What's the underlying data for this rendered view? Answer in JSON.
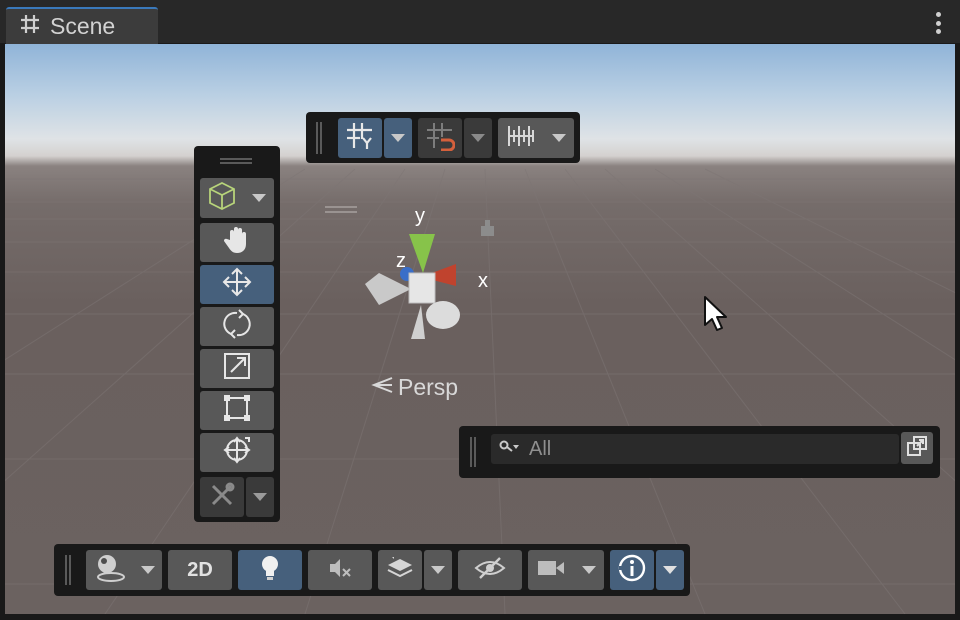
{
  "tab": {
    "title": "Scene",
    "icon": "grid-hash-icon"
  },
  "tab_menu": {
    "icon": "kebab-menu-icon"
  },
  "top_toolbar": {
    "buttons": [
      {
        "icon": "grid-snap-icon",
        "active": true
      },
      {
        "icon": "increment-snap-magnet-icon",
        "active": false
      },
      {
        "icon": "ruler-snap-icon",
        "active": false
      }
    ]
  },
  "tools_toolbar": {
    "tool_context": {
      "icon": "gameobject-cube-icon"
    },
    "tools": [
      {
        "icon": "hand-tool-icon",
        "active": false
      },
      {
        "icon": "move-tool-icon",
        "active": true
      },
      {
        "icon": "rotate-tool-icon",
        "active": false
      },
      {
        "icon": "scale-tool-icon",
        "active": false
      },
      {
        "icon": "rect-tool-icon",
        "active": false
      },
      {
        "icon": "transform-tool-icon",
        "active": false
      }
    ],
    "custom_tool": {
      "icon": "custom-tools-icon"
    }
  },
  "gizmo": {
    "x_label": "x",
    "y_label": "y",
    "z_label": "z",
    "persp_label": "Persp",
    "colors": {
      "x": "#c0432e",
      "y": "#87c34a",
      "z": "#3a6ec8"
    }
  },
  "search": {
    "placeholder": "All",
    "value": ""
  },
  "bottom_toolbar": {
    "draw_mode": {
      "icon": "shaded-draw-mode-icon"
    },
    "mode_2d_label": "2D",
    "lighting": {
      "icon": "lightbulb-icon",
      "active": true
    },
    "audio": {
      "icon": "audio-muted-icon",
      "active": false
    },
    "effects": {
      "icon": "effects-layers-icon"
    },
    "hidden_objects": {
      "icon": "eye-hidden-icon"
    },
    "camera": {
      "icon": "camera-icon"
    },
    "gizmos": {
      "icon": "info-gizmos-icon",
      "active": true
    }
  },
  "accent_color": "#3a79bb"
}
